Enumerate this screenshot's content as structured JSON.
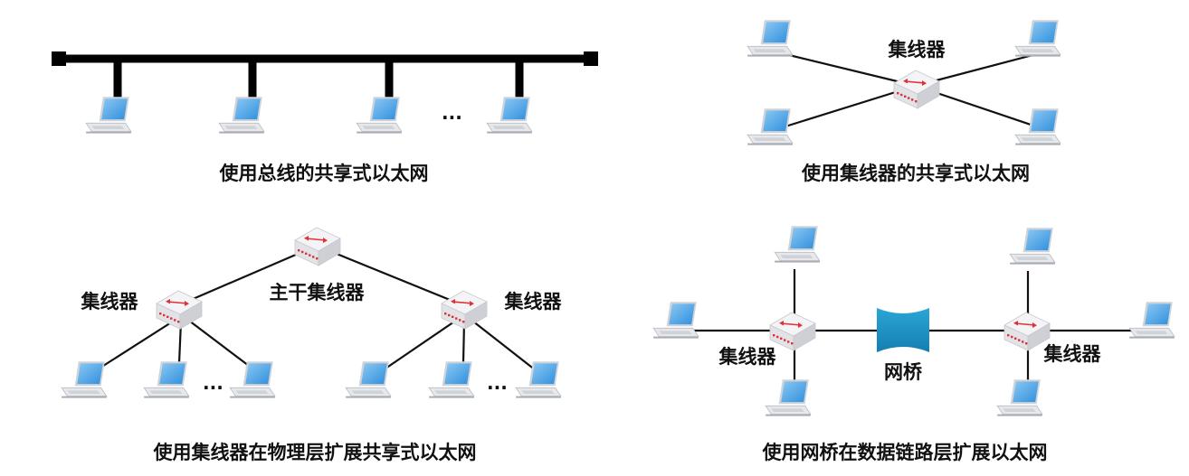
{
  "panels": {
    "bus": {
      "caption": "使用总线的共享式以太网",
      "ellipsis": "..."
    },
    "hub": {
      "caption": "使用集线器的共享式以太网",
      "hub_label": "集线器"
    },
    "hierarchy": {
      "caption": "使用集线器在物理层扩展共享式以太网",
      "backbone_label": "主干集线器",
      "left_hub_label": "集线器",
      "right_hub_label": "集线器",
      "ellipsis_left": "...",
      "ellipsis_right": "..."
    },
    "bridge": {
      "caption": "使用网桥在数据链路层扩展以太网",
      "bridge_label": "网桥",
      "left_hub_label": "集线器",
      "right_hub_label": "集线器"
    }
  },
  "icons": {
    "laptop": "laptop-icon",
    "hub": "hub-icon",
    "bridge": "bridge-icon",
    "bus_terminator": "terminator-icon"
  },
  "colors": {
    "line": "#111111",
    "laptop_screen": "#3b9be0",
    "laptop_body": "#e4e6ea",
    "hub_body": "#e9e9ec",
    "hub_arrow": "#e0303a",
    "bridge": "#1a8fc0"
  }
}
